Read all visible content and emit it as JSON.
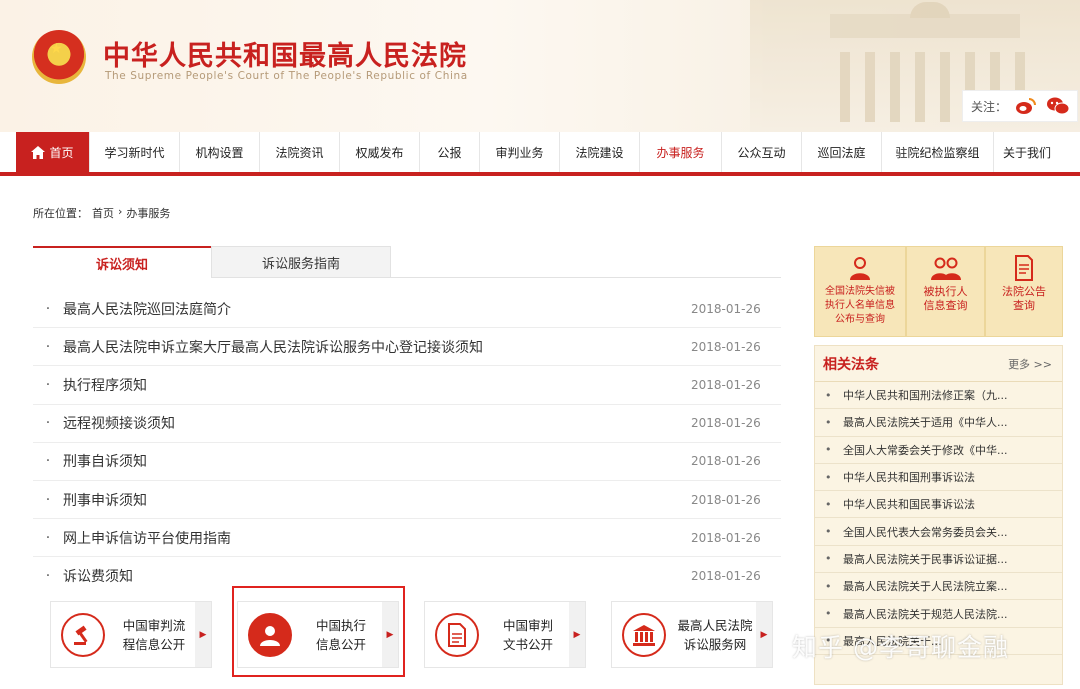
{
  "header": {
    "title": "中华人民共和国最高人民法院",
    "subtitle": "The Supreme People's Court of The People's Republic of China",
    "follow_label": "关注："
  },
  "nav": {
    "items": [
      "首页",
      "学习新时代",
      "机构设置",
      "法院资讯",
      "权威发布",
      "公报",
      "审判业务",
      "法院建设",
      "办事服务",
      "公众互动",
      "巡回法庭",
      "驻院纪检监察组",
      "关于我们"
    ],
    "active": "办事服务"
  },
  "breadcrumb": {
    "label": "所在位置：",
    "home": "首页",
    "sep": "›",
    "current": "办事服务"
  },
  "tabs": [
    "诉讼须知",
    "诉讼服务指南"
  ],
  "notices": [
    {
      "title": "最高人民法院巡回法庭简介",
      "date": "2018-01-26"
    },
    {
      "title": "最高人民法院申诉立案大厅最高人民法院诉讼服务中心登记接谈须知",
      "date": "2018-01-26"
    },
    {
      "title": "执行程序须知",
      "date": "2018-01-26"
    },
    {
      "title": "远程视频接谈须知",
      "date": "2018-01-26"
    },
    {
      "title": "刑事自诉须知",
      "date": "2018-01-26"
    },
    {
      "title": "刑事申诉须知",
      "date": "2018-01-26"
    },
    {
      "title": "网上申诉信访平台使用指南",
      "date": "2018-01-26"
    },
    {
      "title": "诉讼费须知",
      "date": "2018-01-26"
    }
  ],
  "services": [
    {
      "line1": "中国审判流",
      "line2": "程信息公开",
      "icon": "gavel-icon"
    },
    {
      "line1": "中国执行",
      "line2": "信息公开",
      "icon": "person-icon"
    },
    {
      "line1": "中国审判",
      "line2": "文书公开",
      "icon": "document-icon"
    },
    {
      "line1": "最高人民法院",
      "line2": "诉讼服务网",
      "icon": "court-building-icon"
    }
  ],
  "quick_links": [
    {
      "text": "全国法院失信被执行人名单信息公布与查询",
      "icon": "person-icon"
    },
    {
      "text": "被执行人信息查询",
      "icon": "people-icon"
    },
    {
      "text": "法院公告查询",
      "icon": "notice-icon"
    }
  ],
  "laws": {
    "title": "相关法条",
    "more": "更多 >>",
    "items": [
      "中华人民共和国刑法修正案（九...",
      "最高人民法院关于适用《中华人...",
      "全国人大常委会关于修改《中华...",
      "中华人民共和国刑事诉讼法",
      "中华人民共和国民事诉讼法",
      "全国人民代表大会常务委员会关...",
      "最高人民法院关于民事诉讼证据...",
      "最高人民法院关于人民法院立案...",
      "最高人民法院关于规范人民法院...",
      "最高人民法院关于..."
    ]
  },
  "watermark": "知乎 @李哥聊金融",
  "colors": {
    "brand_red": "#c8211f",
    "panel_gold": "#f7e6b9"
  }
}
